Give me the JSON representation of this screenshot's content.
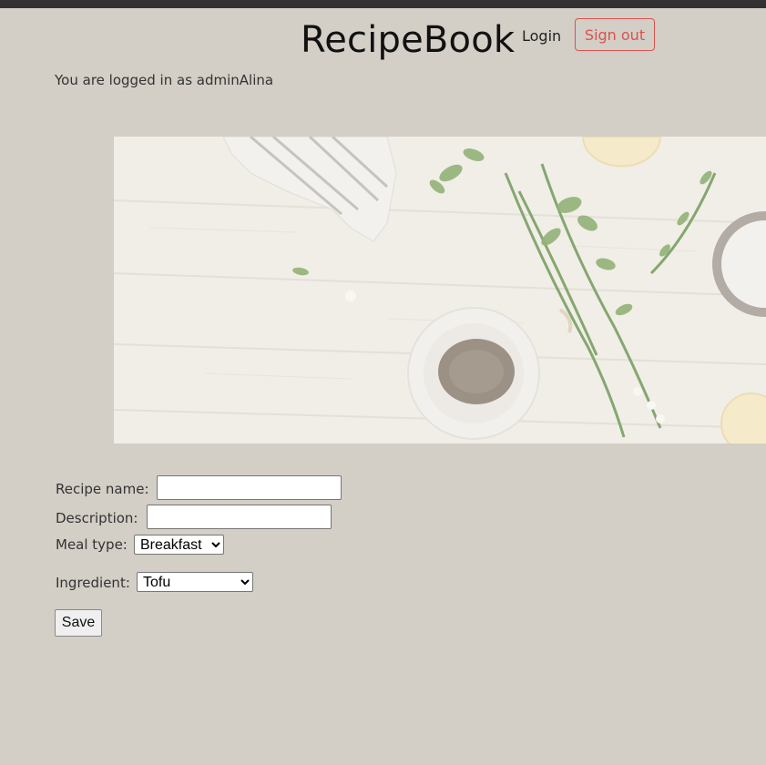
{
  "header": {
    "brand": "RecipeBook",
    "login_label": "Login",
    "signout_label": "Sign out"
  },
  "session": {
    "status_text": "You are logged in as adminAlina"
  },
  "hero": {
    "image": "herbs-on-wooden-table"
  },
  "form": {
    "recipe_name_label": "Recipe name:",
    "recipe_name_value": "",
    "description_label": "Description:",
    "description_value": "",
    "meal_type_label": "Meal type:",
    "meal_type_selected": "Breakfast",
    "ingredient_label": "Ingredient:",
    "ingredient_selected": "Tofu",
    "save_label": "Save"
  },
  "colors": {
    "background": "#d3cec6",
    "topbar": "#333131",
    "signout_accent": "#d9534f"
  }
}
